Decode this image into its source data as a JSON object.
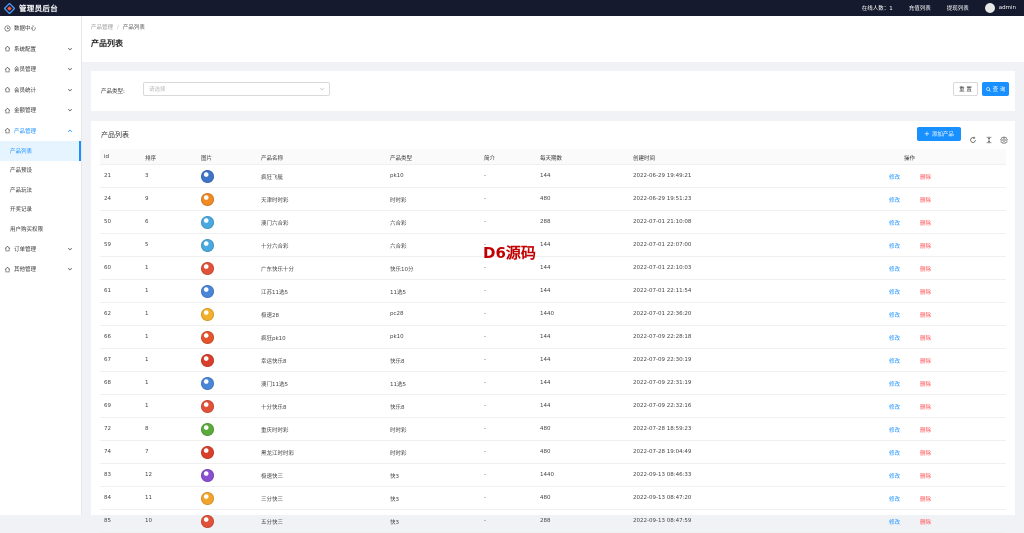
{
  "topbar": {
    "app_title": "管理员后台",
    "online_label": "在线人数：1",
    "recharge_label": "充值列表",
    "withdraw_label": "提现列表",
    "user_name": "admin"
  },
  "sidebar": {
    "items": [
      {
        "label": "数据中心",
        "icon": "clock-icon",
        "has_arrow": false
      },
      {
        "label": "系统配置",
        "icon": "home-icon",
        "has_arrow": true
      },
      {
        "label": "会员管理",
        "icon": "home-icon",
        "has_arrow": true
      },
      {
        "label": "会员统计",
        "icon": "home-icon",
        "has_arrow": true
      },
      {
        "label": "金额管理",
        "icon": "home-icon",
        "has_arrow": true
      },
      {
        "label": "产品管理",
        "icon": "home-icon",
        "has_arrow": true,
        "open": true
      }
    ],
    "sub_items": [
      "产品列表",
      "产品预设",
      "产品玩法",
      "开奖记录",
      "用户购买权限"
    ],
    "active_sub": "产品列表",
    "bottom_items": [
      {
        "label": "订单管理",
        "icon": "home-icon"
      },
      {
        "label": "其他管理",
        "icon": "home-icon"
      }
    ]
  },
  "breadcrumb": {
    "parent": "产品管理",
    "separator": "/",
    "current": "产品列表"
  },
  "page_title": "产品列表",
  "filter": {
    "type_label": "产品类型:",
    "type_placeholder": "请选择",
    "reset_label": "重 置",
    "query_label": "查 询"
  },
  "table": {
    "title": "产品列表",
    "add_label": "添加产品",
    "columns": [
      "id",
      "排序",
      "图片",
      "产品名称",
      "产品类型",
      "简介",
      "每天期数",
      "创建时间",
      "操作"
    ],
    "edit_label": "修改",
    "delete_label": "删除",
    "rows": [
      {
        "id": "21",
        "sort": "3",
        "name": "疯狂飞艇",
        "type": "pk10",
        "intro": "-",
        "periods": "144",
        "created": "2022-06-29 19:49:21",
        "color": "#3f74c9"
      },
      {
        "id": "24",
        "sort": "9",
        "name": "天津时时彩",
        "type": "时时彩",
        "intro": "-",
        "periods": "480",
        "created": "2022-06-29 19:51:23",
        "color": "#f08a24"
      },
      {
        "id": "50",
        "sort": "6",
        "name": "澳门六合彩",
        "type": "六合彩",
        "intro": "-",
        "periods": "288",
        "created": "2022-07-01 21:10:08",
        "color": "#4aa9e0"
      },
      {
        "id": "59",
        "sort": "5",
        "name": "十分六合彩",
        "type": "六合彩",
        "intro": "-",
        "periods": "144",
        "created": "2022-07-01 22:07:00",
        "color": "#4aa9e0"
      },
      {
        "id": "60",
        "sort": "1",
        "name": "广东快乐十分",
        "type": "快乐10分",
        "intro": "-",
        "periods": "144",
        "created": "2022-07-01 22:10:03",
        "color": "#e0533a"
      },
      {
        "id": "61",
        "sort": "1",
        "name": "江苏11选5",
        "type": "11选5",
        "intro": "-",
        "periods": "144",
        "created": "2022-07-01 22:11:54",
        "color": "#4a86d8"
      },
      {
        "id": "62",
        "sort": "1",
        "name": "极速28",
        "type": "pc28",
        "intro": "-",
        "periods": "1440",
        "created": "2022-07-01 22:36:20",
        "color": "#f2b02c"
      },
      {
        "id": "66",
        "sort": "1",
        "name": "疯狂pk10",
        "type": "pk10",
        "intro": "-",
        "periods": "144",
        "created": "2022-07-09 22:28:18",
        "color": "#e4552f"
      },
      {
        "id": "67",
        "sort": "1",
        "name": "幸运快乐8",
        "type": "快乐8",
        "intro": "-",
        "periods": "144",
        "created": "2022-07-09 22:30:19",
        "color": "#d9402b"
      },
      {
        "id": "68",
        "sort": "1",
        "name": "澳门11选5",
        "type": "11选5",
        "intro": "-",
        "periods": "144",
        "created": "2022-07-09 22:31:19",
        "color": "#4a86d8"
      },
      {
        "id": "69",
        "sort": "1",
        "name": "十分快乐8",
        "type": "快乐8",
        "intro": "-",
        "periods": "144",
        "created": "2022-07-09 22:32:16",
        "color": "#e0533a"
      },
      {
        "id": "72",
        "sort": "8",
        "name": "重庆时时彩",
        "type": "时时彩",
        "intro": "-",
        "periods": "480",
        "created": "2022-07-28 18:59:23",
        "color": "#5aab3c"
      },
      {
        "id": "74",
        "sort": "7",
        "name": "黑龙江时时彩",
        "type": "时时彩",
        "intro": "-",
        "periods": "480",
        "created": "2022-07-28 19:04:49",
        "color": "#d9402b"
      },
      {
        "id": "83",
        "sort": "12",
        "name": "极速快三",
        "type": "快3",
        "intro": "-",
        "periods": "1440",
        "created": "2022-09-13 08:46:33",
        "color": "#8a4fd1"
      },
      {
        "id": "84",
        "sort": "11",
        "name": "三分快三",
        "type": "快3",
        "intro": "-",
        "periods": "480",
        "created": "2022-09-13 08:47:20",
        "color": "#f2a52c"
      },
      {
        "id": "85",
        "sort": "10",
        "name": "五分快三",
        "type": "快3",
        "intro": "-",
        "periods": "288",
        "created": "2022-09-13 08:47:59",
        "color": "#e0533a"
      }
    ]
  },
  "watermark": "D6源码"
}
